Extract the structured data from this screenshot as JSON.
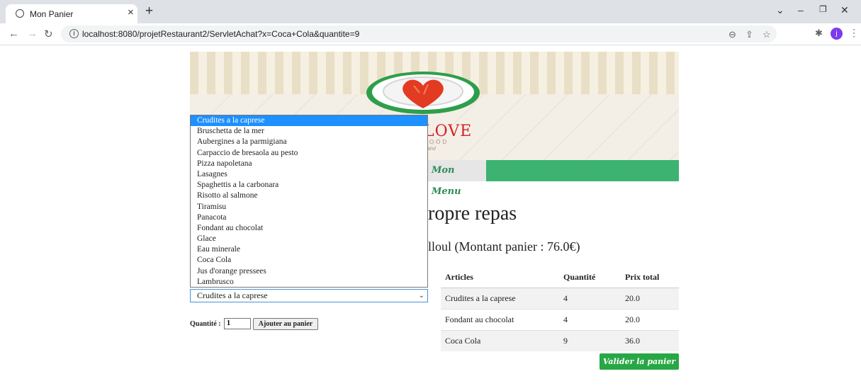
{
  "browser": {
    "tab_title": "Mon Panier",
    "tab_close": "×",
    "new_tab": "+",
    "url": "localhost:8080/projetRestaurant2/ServletAchat?x=Coca+Cola&quantite=9",
    "avatar_letter": "j"
  },
  "banner": {
    "logo_text": "LOVE",
    "logo_sub": "FOOD",
    "logo_script": "Dand"
  },
  "nav": {
    "menu_label": "Mon Menu"
  },
  "main": {
    "heading": "ropre repas",
    "subheading": "lloul (Montant panier : 76.0€)"
  },
  "cart": {
    "headers": [
      "Articles",
      "Quantité",
      "Prix total"
    ],
    "rows": [
      {
        "article": "Crudites a la caprese",
        "quantite": "4",
        "prix": "20.0"
      },
      {
        "article": "Fondant au chocolat",
        "quantite": "4",
        "prix": "20.0"
      },
      {
        "article": "Coca Cola",
        "quantite": "9",
        "prix": "36.0"
      }
    ],
    "validate_label": "Valider la panier ➔"
  },
  "order_form": {
    "selected": "Crudites a la caprese",
    "options": [
      "Crudites a la caprese",
      "Bruschetta de la mer",
      "Aubergines a la parmigiana",
      "Carpaccio de bresaola au pesto",
      "Pizza napoletana",
      "Lasagnes",
      "Spaghettis a la carbonara",
      "Risotto al salmone",
      "Tiramisu",
      "Panacota",
      "Fondant au chocolat",
      "Glace",
      "Eau minerale",
      "Coca Cola",
      "Jus d'orange pressees",
      "Lambrusco"
    ],
    "quantity_label": "Quantité :",
    "quantity_value": "1",
    "add_button": "Ajouter au panier"
  },
  "colors": {
    "accent_green": "#3cb371",
    "button_green": "#28a745",
    "selection_blue": "#1e90ff"
  }
}
